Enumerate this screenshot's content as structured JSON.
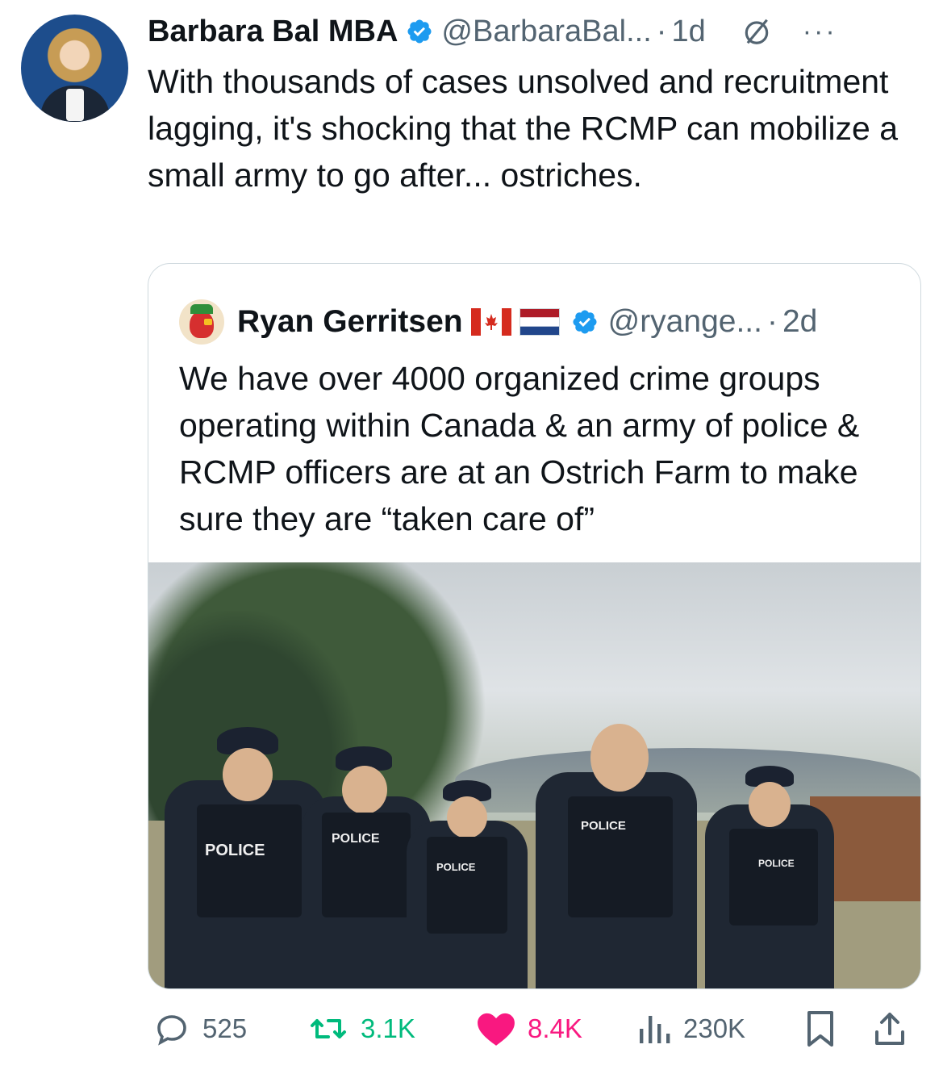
{
  "tweet": {
    "author_name": "Barbara Bal MBA",
    "handle": "@BarbaraBal...",
    "separator": "·",
    "time": "1d",
    "more": "···",
    "text": "With thousands of cases unsolved and recruitment lagging, it's shocking that the RCMP can mobilize a small army to go after... ostriches."
  },
  "quote": {
    "author_name": "Ryan Gerritsen",
    "handle": "@ryange...",
    "separator": "·",
    "time": "2d",
    "text": "We have over 4000 organized crime groups operating within Canada & an army of police & RCMP officers are at an Ostrich Farm to make sure they are “taken care of”",
    "media": {
      "patch_labels": [
        "POLICE",
        "POLICE",
        "POLICE",
        "POLICE",
        "POLICE"
      ]
    }
  },
  "actions": {
    "replies": "525",
    "reposts": "3.1K",
    "likes": "8.4K",
    "views": "230K"
  },
  "colors": {
    "verified": "#1d9bf0",
    "repost": "#00ba7c",
    "like": "#f91880",
    "text": "#0f1419",
    "secondary": "#536471",
    "border": "#cfd9de"
  }
}
